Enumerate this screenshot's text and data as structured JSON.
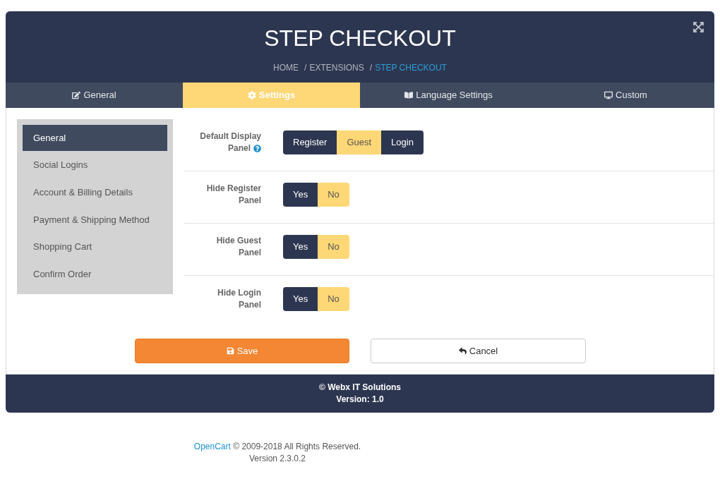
{
  "header": {
    "title": "STEP CHECKOUT",
    "breadcrumb": [
      {
        "kind": "link",
        "label": "HOME",
        "current": false
      },
      {
        "kind": "separator",
        "label": "/"
      },
      {
        "kind": "link",
        "label": "EXTENSIONS",
        "current": false
      },
      {
        "kind": "separator",
        "label": "/"
      },
      {
        "kind": "link",
        "label": "STEP CHECKOUT",
        "current": true
      }
    ]
  },
  "tabs": [
    {
      "label": "General",
      "selected": false
    },
    {
      "label": "Settings",
      "selected": true
    },
    {
      "label": "Language Settings",
      "selected": false
    },
    {
      "label": "Custom",
      "selected": false
    }
  ],
  "sidebar": {
    "items": [
      {
        "label": "General",
        "selected": true
      },
      {
        "label": "Social Logins",
        "selected": false
      },
      {
        "label": "Account & Billing Details",
        "selected": false
      },
      {
        "label": "Payment & Shipping Method",
        "selected": false
      },
      {
        "label": "Shopping Cart",
        "selected": false
      },
      {
        "label": "Confirm Order",
        "selected": false
      }
    ]
  },
  "settings": [
    {
      "label_lines": [
        "Default Display",
        "Panel"
      ],
      "help": true,
      "options": [
        {
          "label": "Register",
          "selected": false
        },
        {
          "label": "Guest",
          "selected": true
        },
        {
          "label": "Login",
          "selected": false
        }
      ]
    },
    {
      "label_lines": [
        "Hide Register",
        "Panel"
      ],
      "help": false,
      "options": [
        {
          "label": "Yes",
          "selected": false
        },
        {
          "label": "No",
          "selected": true
        }
      ]
    },
    {
      "label_lines": [
        "Hide Guest",
        "Panel"
      ],
      "help": false,
      "options": [
        {
          "label": "Yes",
          "selected": false
        },
        {
          "label": "No",
          "selected": true
        }
      ]
    },
    {
      "label_lines": [
        "Hide Login",
        "Panel"
      ],
      "help": false,
      "options": [
        {
          "label": "Yes",
          "selected": false
        },
        {
          "label": "No",
          "selected": true
        }
      ]
    }
  ],
  "buttons": {
    "save": "Save",
    "cancel": "Cancel"
  },
  "footer": {
    "copyright": "© Webx IT Solutions",
    "version": "Version: 1.0"
  },
  "page_footer": {
    "link": "OpenCart",
    "text": "© 2009-2018 All Rights Reserved.",
    "version": "Version 2.3.0.2"
  }
}
